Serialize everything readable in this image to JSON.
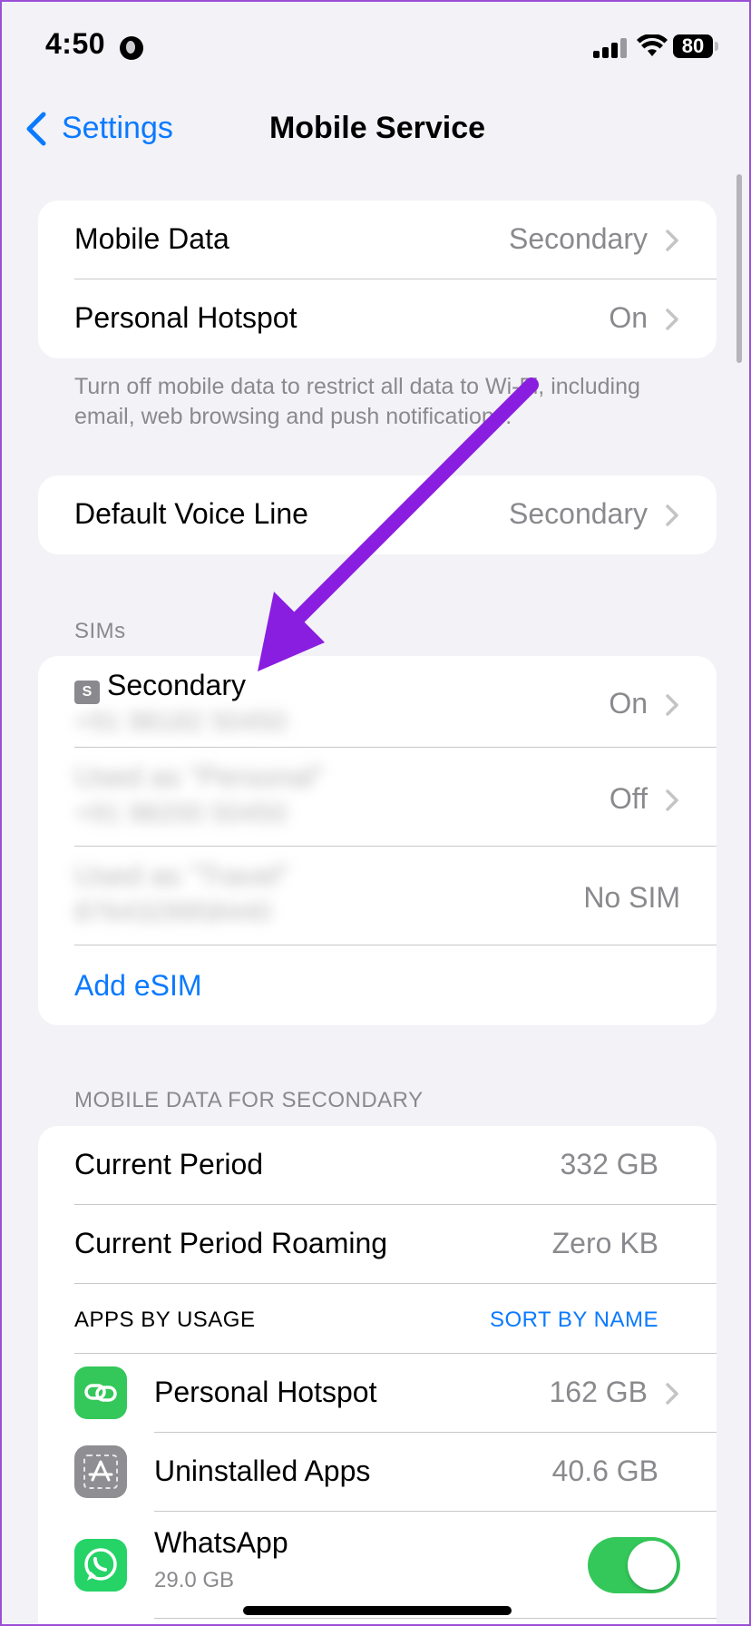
{
  "status_bar": {
    "time": "4:50",
    "battery": "80"
  },
  "nav": {
    "back_label": "Settings",
    "title": "Mobile Service"
  },
  "group1": {
    "rows": [
      {
        "title": "Mobile Data",
        "value": "Secondary"
      },
      {
        "title": "Personal Hotspot",
        "value": "On"
      }
    ],
    "footer": "Turn off mobile data to restrict all data to Wi-Fi, including email, web browsing and push notifications."
  },
  "voice": {
    "title": "Default Voice Line",
    "value": "Secondary"
  },
  "sims": {
    "header": "SIMs",
    "items": [
      {
        "badge": "S",
        "name": "Secondary",
        "number": "+91 98182 50450",
        "value": "On"
      },
      {
        "name": "Used as \"Personal\"",
        "number": "+91 98200 50450",
        "value": "Off"
      },
      {
        "name": "Used as \"Travel\"",
        "number": "8764329958440",
        "value": "No SIM"
      }
    ],
    "add_esim": "Add eSIM"
  },
  "mobile_data": {
    "header": "MOBILE DATA FOR SECONDARY",
    "rows": [
      {
        "title": "Current Period",
        "value": "332 GB"
      },
      {
        "title": "Current Period Roaming",
        "value": "Zero KB"
      }
    ],
    "apps_header": "APPS BY USAGE",
    "sort_label": "SORT BY NAME",
    "apps": [
      {
        "name": "Personal Hotspot",
        "value": "162 GB",
        "icon": "hotspot-icon",
        "color": "#34c759"
      },
      {
        "name": "Uninstalled Apps",
        "value": "40.6 GB",
        "icon": "uninstalled-apps-icon",
        "color": "#8e8e93"
      },
      {
        "name": "WhatsApp",
        "subtitle": "29.0 GB",
        "icon": "whatsapp-icon",
        "color": "#25d366",
        "enabled": true
      }
    ]
  },
  "colors": {
    "accent": "#0a7aff",
    "annotation_arrow": "#8a1ee0"
  }
}
